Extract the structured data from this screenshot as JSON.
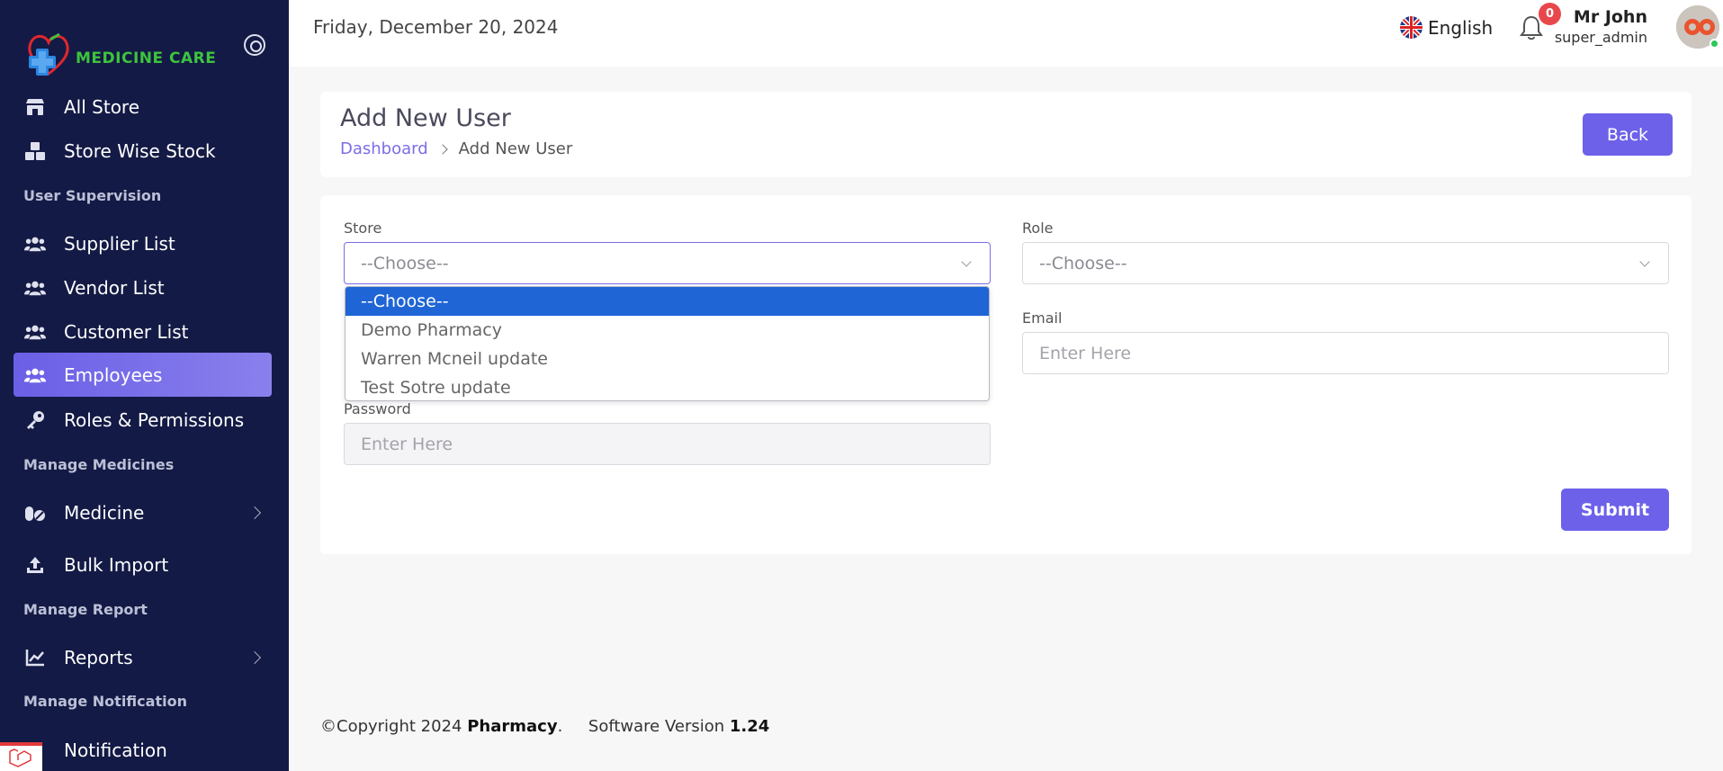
{
  "brand": {
    "name": "MEDICINE CARE"
  },
  "colors": {
    "sidebar_bg": "#131a45",
    "accent": "#6d61ea",
    "brand_green": "#3ec33e",
    "dropdown_selected": "#1f65d6",
    "badge_red": "#e8484c"
  },
  "sidebar": {
    "items": [
      {
        "label": "All Store",
        "icon": "store-icon"
      },
      {
        "label": "Store Wise Stock",
        "icon": "boxes-icon"
      },
      {
        "label": "Supplier List",
        "icon": "users-icon"
      },
      {
        "label": "Vendor List",
        "icon": "users-icon"
      },
      {
        "label": "Customer List",
        "icon": "users-icon"
      },
      {
        "label": "Employees",
        "icon": "users-icon",
        "active": true
      },
      {
        "label": "Roles & Permissions",
        "icon": "key-icon"
      },
      {
        "label": "Medicine",
        "icon": "pills-icon",
        "has_submenu": true
      },
      {
        "label": "Bulk Import",
        "icon": "upload-icon"
      },
      {
        "label": "Reports",
        "icon": "chart-line-icon",
        "has_submenu": true
      },
      {
        "label": "Notification",
        "icon": "bell-icon"
      }
    ],
    "sections": [
      "User Supervision",
      "Manage Medicines",
      "Manage Report",
      "Manage Notification"
    ]
  },
  "topbar": {
    "date": "Friday, December 20, 2024",
    "language": "English",
    "notification_count": "0",
    "user_name": "Mr John",
    "user_role": "super_admin"
  },
  "header": {
    "title": "Add New User",
    "breadcrumb": {
      "home": "Dashboard",
      "current": "Add New User"
    },
    "back_label": "Back"
  },
  "form": {
    "store": {
      "label": "Store",
      "value": "--Choose--"
    },
    "role": {
      "label": "Role",
      "value": "--Choose--"
    },
    "email": {
      "label": "Email",
      "placeholder": "Enter Here"
    },
    "password": {
      "label": "Password",
      "placeholder": "Enter Here"
    },
    "submit_label": "Submit"
  },
  "store_dropdown": {
    "options": [
      "--Choose--",
      "Demo Pharmacy",
      "Warren Mcneil update",
      "Test Sotre update"
    ],
    "selected_index": 0
  },
  "footer": {
    "copyright": "©Copyright 2024 ",
    "company": "Pharmacy",
    "dot": ".",
    "version_label": "Software Version ",
    "version": "1.24"
  }
}
